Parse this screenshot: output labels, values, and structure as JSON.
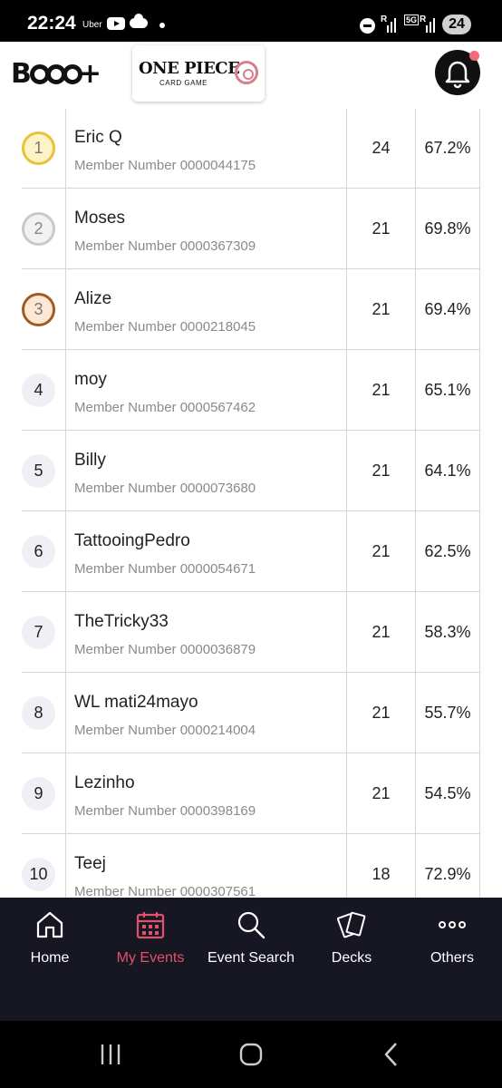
{
  "status_bar": {
    "time": "22:24",
    "app_label": "Uber",
    "network": "5G",
    "signal_r1": "R",
    "signal_r2": "R",
    "battery": "24"
  },
  "header": {
    "brand_logo": "B",
    "brand_suffix": "+",
    "game_title": "ONE PIECE",
    "game_subtitle": "CARD GAME",
    "bell_icon": "bell-icon",
    "notification_dot_color": "#f26b78"
  },
  "standings": [
    {
      "rank": "1",
      "name": "Eric Q",
      "member": "Member Number 0000044175",
      "points": "24",
      "omw": "67.2%",
      "medal": "gold"
    },
    {
      "rank": "2",
      "name": "Moses",
      "member": "Member Number 0000367309",
      "points": "21",
      "omw": "69.8%",
      "medal": "silver"
    },
    {
      "rank": "3",
      "name": "Alize",
      "member": "Member Number 0000218045",
      "points": "21",
      "omw": "69.4%",
      "medal": "bronze"
    },
    {
      "rank": "4",
      "name": "moy",
      "member": "Member Number 0000567462",
      "points": "21",
      "omw": "65.1%",
      "medal": ""
    },
    {
      "rank": "5",
      "name": "Billy",
      "member": "Member Number 0000073680",
      "points": "21",
      "omw": "64.1%",
      "medal": ""
    },
    {
      "rank": "6",
      "name": "TattooingPedro",
      "member": "Member Number 0000054671",
      "points": "21",
      "omw": "62.5%",
      "medal": ""
    },
    {
      "rank": "7",
      "name": "TheTricky33",
      "member": "Member Number 0000036879",
      "points": "21",
      "omw": "58.3%",
      "medal": ""
    },
    {
      "rank": "8",
      "name": "WL mati24mayo",
      "member": "Member Number 0000214004",
      "points": "21",
      "omw": "55.7%",
      "medal": ""
    },
    {
      "rank": "9",
      "name": "Lezinho",
      "member": "Member Number 0000398169",
      "points": "21",
      "omw": "54.5%",
      "medal": ""
    },
    {
      "rank": "10",
      "name": "Teej",
      "member": "Member Number 0000307561",
      "points": "18",
      "omw": "72.9%",
      "medal": ""
    }
  ],
  "bottom_nav": [
    {
      "label": "Home",
      "icon": "home-icon",
      "active": false
    },
    {
      "label": "My Events",
      "icon": "calendar-icon",
      "active": true
    },
    {
      "label": "Event Search",
      "icon": "search-icon",
      "active": false
    },
    {
      "label": "Decks",
      "icon": "cards-icon",
      "active": false
    },
    {
      "label": "Others",
      "icon": "more-icon",
      "active": false
    }
  ],
  "colors": {
    "active_nav": "#e2506b",
    "nav_background": "#161722"
  }
}
